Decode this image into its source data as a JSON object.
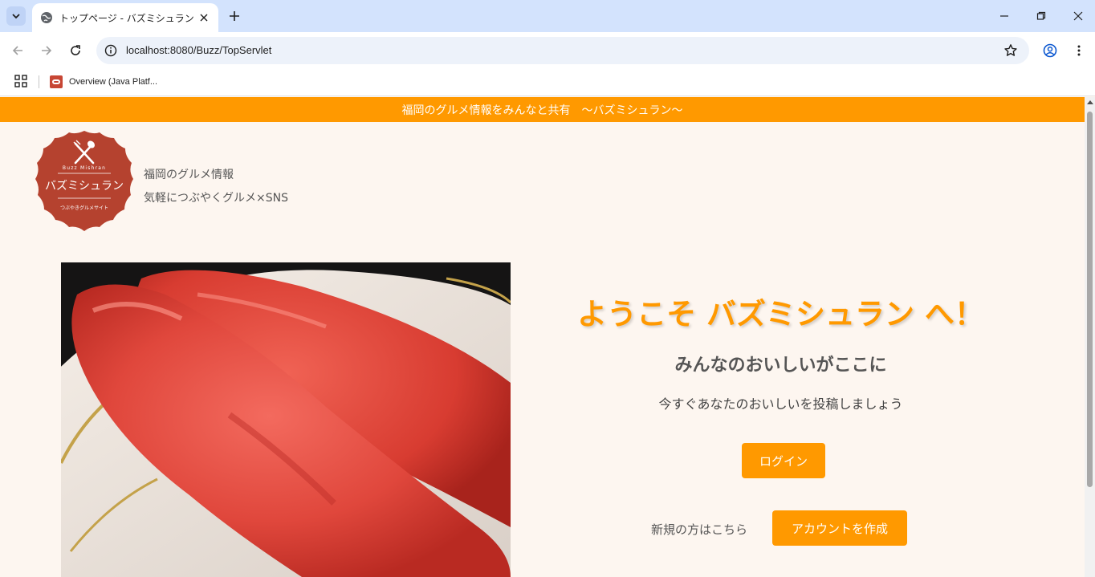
{
  "browser": {
    "tab_title": "トップページ - バズミシュラン",
    "url": "localhost:8080/Buzz/TopServlet",
    "bookmark_label": "Overview (Java Platf..."
  },
  "banner": {
    "text": "福岡のグルメ情報をみんなと共有　～バズミシュラン～"
  },
  "logo": {
    "top_text": "Buzz Mishran",
    "main_text": "バズミシュラン",
    "bottom_text": "つぶやきグルメサイト"
  },
  "tagline": {
    "line1": "福岡のグルメ情報",
    "line2": "気軽につぶやくグルメ×SNS"
  },
  "hero": {
    "welcome": "ようこそ バズミシュラン へ！",
    "subtitle": "みんなのおいしいがここに",
    "description": "今すぐあなたのおいしいを投稿しましょう"
  },
  "actions": {
    "login_label": "ログイン",
    "signup_prompt": "新規の方はこちら",
    "create_account_label": "アカウントを作成"
  },
  "colors": {
    "accent": "#ff9900",
    "page_bg": "#fdf6f0",
    "logo_red": "#b5422f"
  }
}
